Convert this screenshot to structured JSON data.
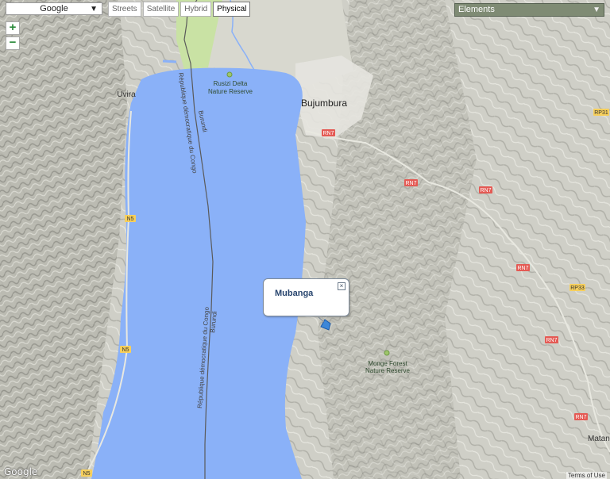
{
  "toolbar": {
    "provider": "Google",
    "map_types": [
      "Streets",
      "Satellite",
      "Hybrid",
      "Physical"
    ],
    "active_map_type": "Physical",
    "elements_label": "Elements",
    "zoom_in": "+",
    "zoom_out": "−"
  },
  "popup": {
    "title": "Mubanga",
    "close": "×"
  },
  "places": {
    "bujumbura": "Bujumbura",
    "uvira": "Uvira",
    "rusizi_1": "Rusizi Delta",
    "rusizi_2": "Nature Reserve",
    "monge_1": "Monge Forest",
    "monge_2": "Nature Reserve",
    "matana": "Matana"
  },
  "borders": {
    "burundi": "Burundi",
    "congo": "République démocratique du Congo"
  },
  "roads": {
    "rn7": "RN7",
    "rp31": "RP31",
    "rp33": "RP33",
    "n5": "N5"
  },
  "footer": {
    "logo": "Google",
    "terms": "Terms of Use"
  },
  "colors": {
    "lake": "#8ab1f8",
    "terrain": "#cfcfc7",
    "park": "#c9e2a4",
    "city": "#e6e4df"
  }
}
